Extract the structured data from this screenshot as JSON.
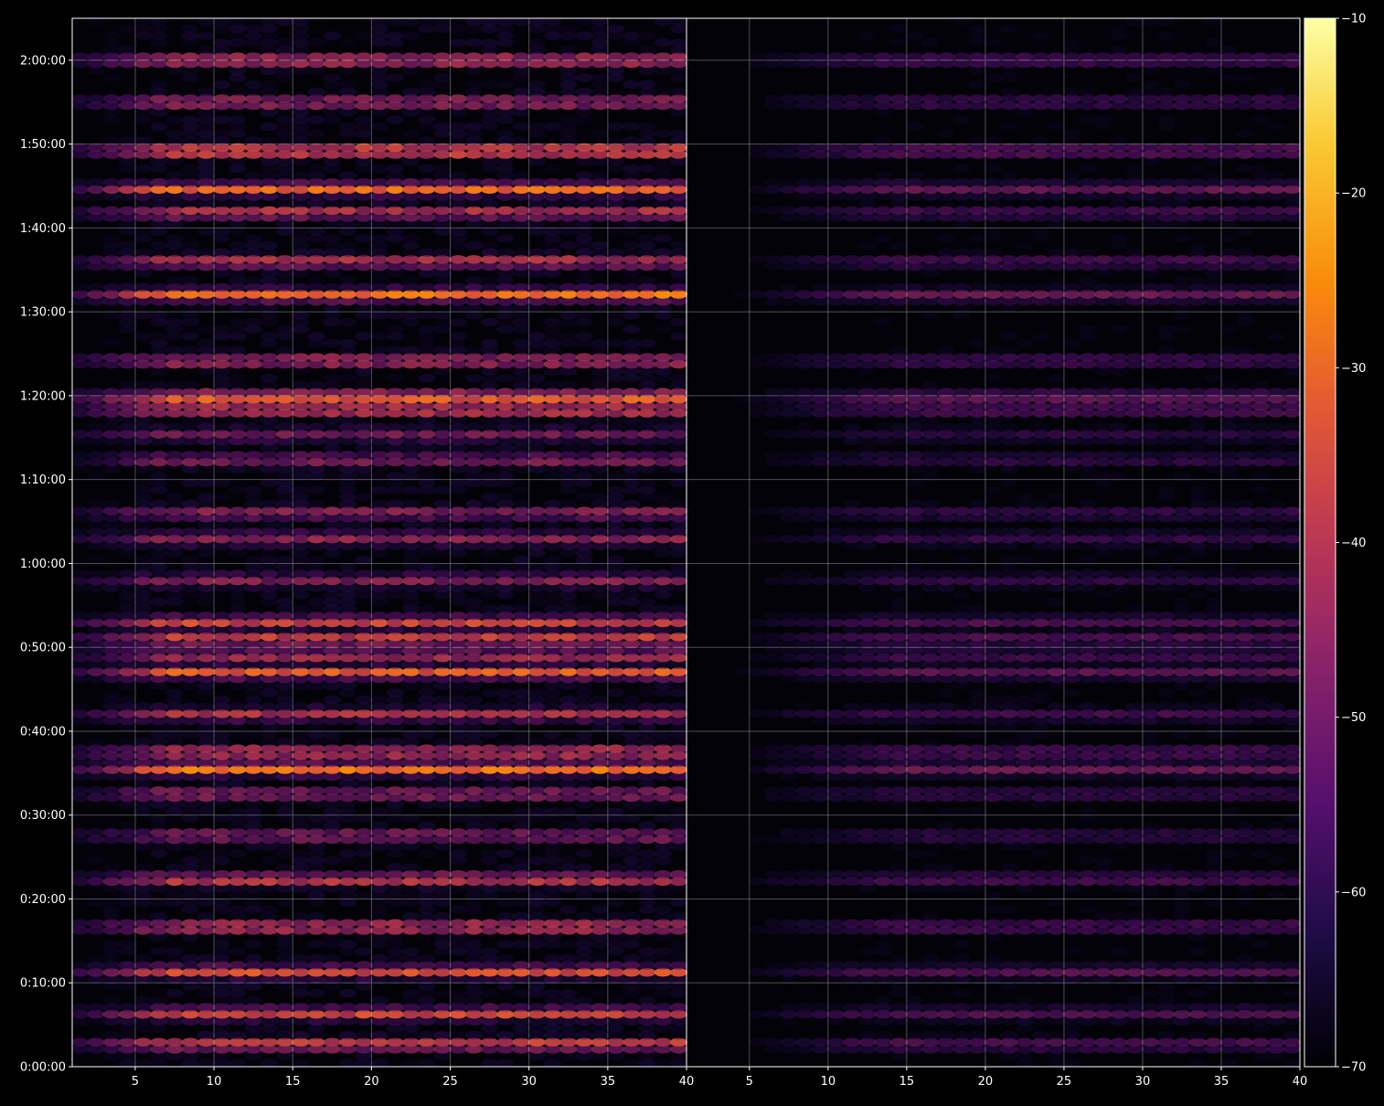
{
  "chart_data": {
    "type": "heatmap",
    "title": "",
    "xlabel": "",
    "ylabel": "",
    "background_color": "#000000",
    "colormap": "inferno",
    "grid": true,
    "panels": [
      {
        "name": "",
        "x_range": [
          1,
          40
        ],
        "x_ticks": [
          5,
          10,
          15,
          20,
          25,
          30,
          35,
          40
        ],
        "x_tick_labels": [
          "5",
          "10",
          "15",
          "20",
          "25",
          "30",
          "35",
          "40"
        ],
        "intensity_scale": 1.0
      },
      {
        "name": "",
        "x_range": [
          1,
          40
        ],
        "x_ticks": [
          5,
          10,
          15,
          20,
          25,
          30,
          35,
          40
        ],
        "x_tick_labels": [
          "5",
          "10",
          "15",
          "20",
          "25",
          "30",
          "35",
          "40"
        ],
        "intensity_scale": 0.55
      }
    ],
    "y_range_seconds": [
      0,
      7500
    ],
    "y_ticks_seconds": [
      0,
      600,
      1200,
      1800,
      2400,
      3000,
      3600,
      4200,
      4800,
      5400,
      6000,
      6600,
      7200
    ],
    "y_tick_labels": [
      "0:00:00",
      "0:10:00",
      "0:20:00",
      "0:30:00",
      "0:40:00",
      "0:50:00",
      "1:00:00",
      "1:10:00",
      "1:20:00",
      "1:30:00",
      "1:40:00",
      "1:50:00",
      "2:00:00"
    ],
    "colorbar": {
      "min": -70,
      "max": -10,
      "ticks": [
        -10,
        -20,
        -30,
        -40,
        -50,
        -60,
        -70
      ],
      "tick_labels": [
        "−10",
        "−20",
        "−30",
        "−40",
        "−50",
        "−60",
        "−70"
      ]
    },
    "hot_bands": [
      {
        "time_s": 7200,
        "level": -32
      },
      {
        "time_s": 6900,
        "level": -36
      },
      {
        "time_s": 6550,
        "level": -24
      },
      {
        "time_s": 6280,
        "level": -28
      },
      {
        "time_s": 6110,
        "level": -34
      },
      {
        "time_s": 5760,
        "level": -34
      },
      {
        "time_s": 5520,
        "level": -26
      },
      {
        "time_s": 5050,
        "level": -34
      },
      {
        "time_s": 4790,
        "level": -24
      },
      {
        "time_s": 4700,
        "level": -28
      },
      {
        "time_s": 4520,
        "level": -46
      },
      {
        "time_s": 4340,
        "level": -42
      },
      {
        "time_s": 3960,
        "level": -40
      },
      {
        "time_s": 3780,
        "level": -42
      },
      {
        "time_s": 3480,
        "level": -44
      },
      {
        "time_s": 3180,
        "level": -34
      },
      {
        "time_s": 3060,
        "level": -30
      },
      {
        "time_s": 2940,
        "level": -36
      },
      {
        "time_s": 2820,
        "level": -30
      },
      {
        "time_s": 2520,
        "level": -38
      },
      {
        "time_s": 2250,
        "level": -30
      },
      {
        "time_s": 2130,
        "level": -26
      },
      {
        "time_s": 1950,
        "level": -38
      },
      {
        "time_s": 1650,
        "level": -40
      },
      {
        "time_s": 1340,
        "level": -32
      },
      {
        "time_s": 1000,
        "level": -30
      },
      {
        "time_s": 680,
        "level": -32
      },
      {
        "time_s": 380,
        "level": -34
      },
      {
        "time_s": 160,
        "level": -30
      }
    ]
  }
}
